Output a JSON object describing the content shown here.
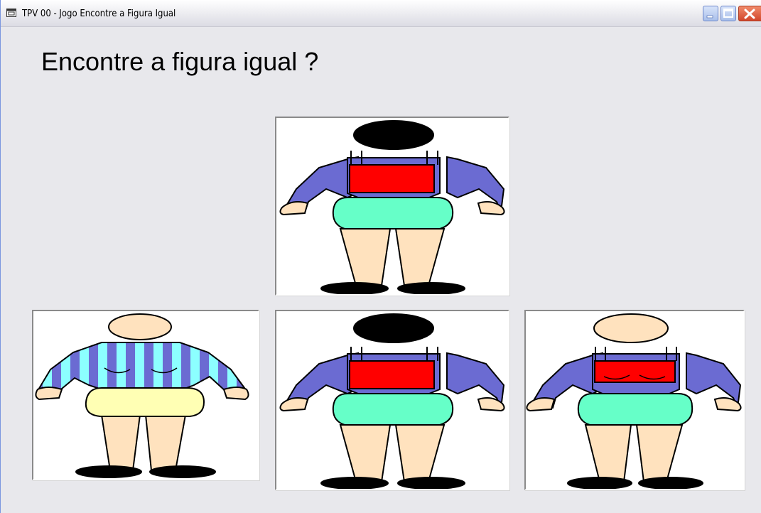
{
  "window": {
    "title": "TPV 00 - Jogo Encontre a Figura Igual",
    "icon": "app-window-icon",
    "controls": [
      "minimize-icon",
      "maximize-icon",
      "close-icon"
    ]
  },
  "game": {
    "question": "Encontre a figura igual ?",
    "target": {
      "head": "black",
      "shirt": "blue-red-apron",
      "skirt": "mint"
    },
    "options": [
      {
        "head": "skin",
        "shirt": "striped-cyan-blue",
        "skirt": "pale-yellow"
      },
      {
        "head": "black",
        "shirt": "blue-red-apron",
        "skirt": "mint"
      },
      {
        "head": "skin",
        "shirt": "blue-red-apron-stitched",
        "skirt": "mint"
      }
    ]
  },
  "colors": {
    "shirt_blue": "#6B6BD2",
    "apron_red": "#FF0000",
    "skirt_mint": "#66FFC8",
    "skin": "#FFE2BE",
    "skirt_yellow": "#FFFFB4",
    "stripe_cyan": "#8CFFFF",
    "hair_black": "#000000"
  }
}
